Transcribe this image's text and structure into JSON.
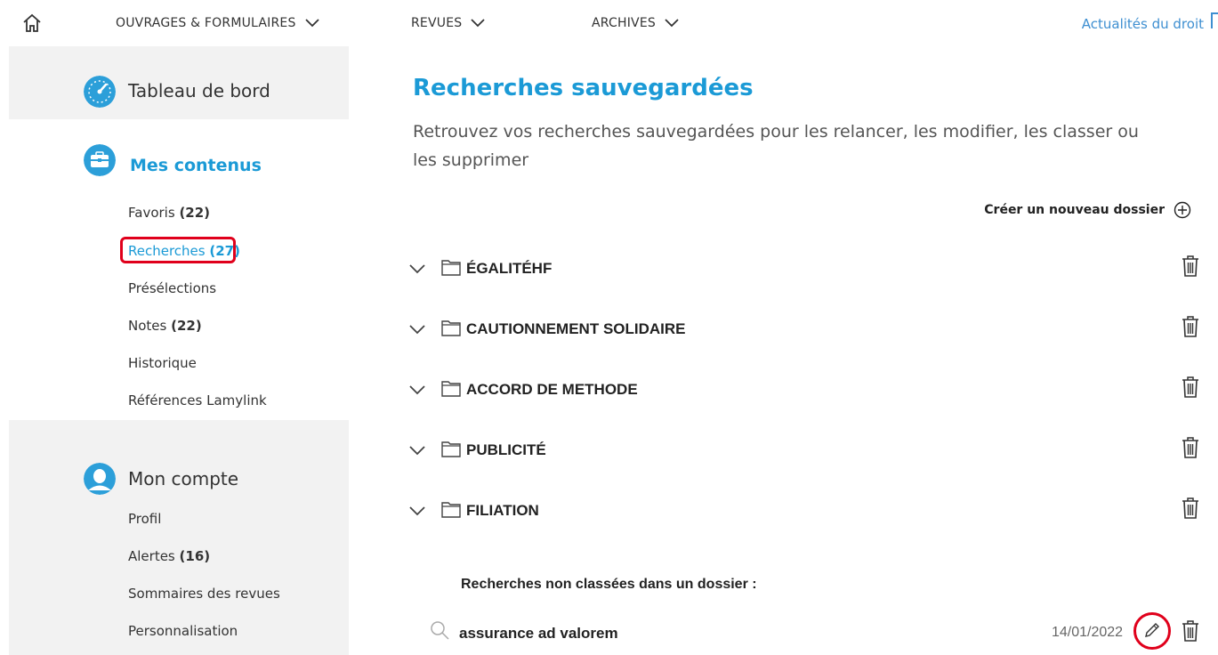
{
  "topnav": {
    "items": [
      {
        "label": "OUVRAGES & FORMULAIRES"
      },
      {
        "label": "REVUES"
      },
      {
        "label": "ARCHIVES"
      }
    ],
    "news_label": "Actualités du droit"
  },
  "sidebar": {
    "dashboard_label": "Tableau de bord",
    "my_content": {
      "title": "Mes contenus",
      "items": [
        {
          "label": "Favoris",
          "count": "(22)"
        },
        {
          "label": "Recherches",
          "count": "(27)"
        },
        {
          "label": "Présélections",
          "count": ""
        },
        {
          "label": "Notes",
          "count": "(22)"
        },
        {
          "label": "Historique",
          "count": ""
        },
        {
          "label": "Références Lamylink",
          "count": ""
        }
      ]
    },
    "account": {
      "title": "Mon compte",
      "items": [
        {
          "label": "Profil",
          "count": ""
        },
        {
          "label": "Alertes",
          "count": "(16)"
        },
        {
          "label": "Sommaires des revues",
          "count": ""
        },
        {
          "label": "Personnalisation",
          "count": ""
        }
      ]
    }
  },
  "main": {
    "title": "Recherches sauvegardées",
    "description": "Retrouvez vos recherches sauvegardées pour les relancer, les modifier, les classer ou les supprimer",
    "create_folder_label": "Créer un nouveau dossier",
    "folders": [
      {
        "name": "ÉGALITÉHF"
      },
      {
        "name": "CAUTIONNEMENT SOLIDAIRE"
      },
      {
        "name": "ACCORD DE METHODE"
      },
      {
        "name": "PUBLICITÉ"
      },
      {
        "name": "FILIATION"
      }
    ],
    "unsorted_label": "Recherches non classées dans un dossier :",
    "searches": [
      {
        "name": "assurance ad valorem",
        "date": "14/01/2022"
      }
    ]
  },
  "colors": {
    "accent": "#1b9ad6",
    "highlight": "#e0001b",
    "sidebar_bg": "#f2f2f2"
  },
  "icons": [
    "home-icon",
    "chevron-down-icon",
    "dashboard-icon",
    "briefcase-icon",
    "user-icon",
    "plus-circle-icon",
    "folder-icon",
    "trash-icon",
    "search-icon",
    "pencil-icon"
  ]
}
